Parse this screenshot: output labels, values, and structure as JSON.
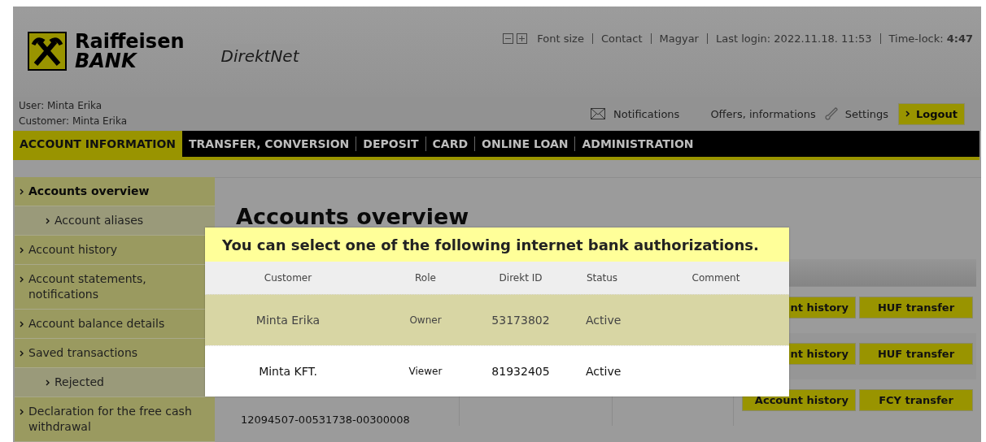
{
  "header": {
    "logo_line1": "Raiffeisen",
    "logo_line2": "BANK",
    "product": "DirektNet",
    "top_links": [
      "Font size",
      "Contact",
      "Magyar",
      "Last login: 2022.11.18. 11:53"
    ],
    "time_lock": {
      "label": "Time-lock:",
      "value": "4:47"
    }
  },
  "user_info": [
    "User: Minta Erika",
    "Customer: Minta Erika"
  ],
  "actions": {
    "notifications": "Notifications",
    "offers": "Offers, informations",
    "settings": "Settings",
    "logout": "Logout"
  },
  "nav": [
    {
      "label": "ACCOUNT INFORMATION",
      "selected": true
    },
    {
      "label": "TRANSFER, CONVERSION",
      "selected": false
    },
    {
      "label": "DEPOSIT",
      "selected": false
    },
    {
      "label": "CARD",
      "selected": false
    },
    {
      "label": "ONLINE LOAN",
      "selected": false
    },
    {
      "label": "ADMINISTRATION",
      "selected": false
    }
  ],
  "sidebar": [
    {
      "label": "Accounts overview",
      "selected": true,
      "children": [
        {
          "label": "Account aliases",
          "selected": false
        }
      ]
    },
    {
      "label": "Account history",
      "selected": false
    },
    {
      "label": "Account statements, notifications",
      "selected": false
    },
    {
      "label": "Account balance details",
      "selected": false
    },
    {
      "label": "Saved transactions",
      "selected": false,
      "children": [
        {
          "label": "Rejected",
          "selected": false
        }
      ]
    },
    {
      "label": "Declaration for the free cash withdrawal",
      "selected": false
    }
  ],
  "page_title": "Accounts overview",
  "accounts": [
    {
      "buttons": [
        "nt history",
        "HUF transfer"
      ]
    },
    {
      "buttons": [
        "nt history",
        "HUF transfer"
      ]
    },
    {
      "account_number": "12094507-00531738-00300008",
      "buttons": [
        "Account history",
        "FCY transfer"
      ]
    }
  ],
  "modal": {
    "title": "You can select one of the following internet bank authorizations.",
    "columns": [
      "Customer",
      "Role",
      "Direkt ID",
      "Status",
      "Comment"
    ],
    "rows": [
      {
        "customer": "Minta Erika",
        "role": "Owner",
        "direkt_id": "53173802",
        "status": "Active",
        "selected": true
      },
      {
        "customer": "Minta KFT.",
        "role": "Viewer",
        "direkt_id": "81932405",
        "status": "Active",
        "selected": false
      }
    ]
  }
}
